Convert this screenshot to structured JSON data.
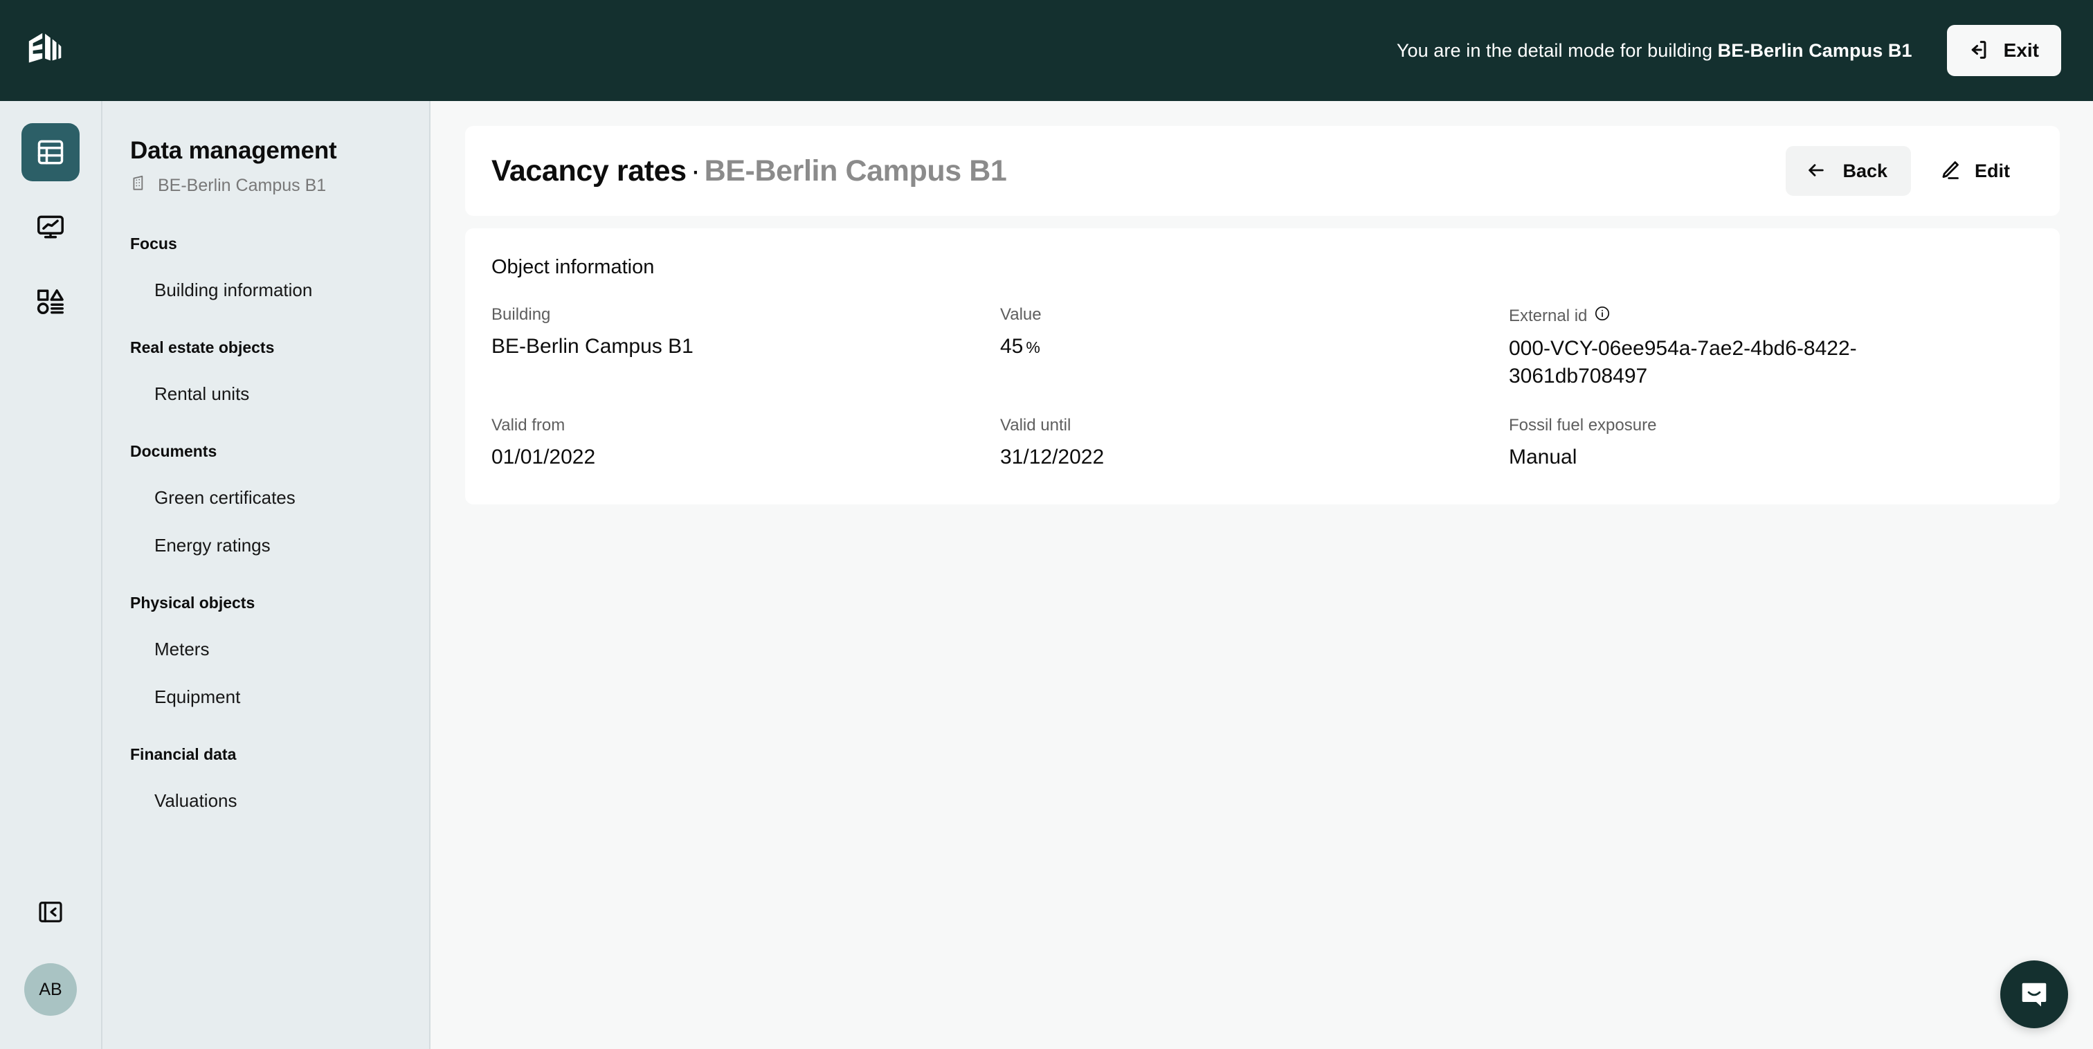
{
  "topbar": {
    "logo_icon": "building-logo-icon",
    "message_prefix": "You are in the detail mode for building ",
    "message_building": "BE-Berlin Campus B1",
    "exit_label": "Exit",
    "exit_icon": "exit-arrow-icon",
    "bg_color": "#14302F"
  },
  "rail": {
    "items": [
      {
        "name": "data-management",
        "icon": "table-grid-icon",
        "active": true
      },
      {
        "name": "monitoring",
        "icon": "monitor-chart-icon",
        "active": false
      },
      {
        "name": "categories",
        "icon": "shapes-list-icon",
        "active": false
      }
    ],
    "collapse_icon": "collapse-panel-icon",
    "avatar_initials": "AB",
    "avatar_color": "#A9C3C3",
    "active_color": "#2C5F67"
  },
  "sidebar": {
    "title": "Data management",
    "subtitle": "BE-Berlin Campus B1",
    "subtitle_icon": "building-icon",
    "groups": [
      {
        "label": "Focus",
        "items": [
          "Building information"
        ]
      },
      {
        "label": "Real estate objects",
        "items": [
          "Rental units"
        ]
      },
      {
        "label": "Documents",
        "items": [
          "Green certificates",
          "Energy ratings"
        ]
      },
      {
        "label": "Physical objects",
        "items": [
          "Meters",
          "Equipment"
        ]
      },
      {
        "label": "Financial data",
        "items": [
          "Valuations"
        ]
      }
    ]
  },
  "main": {
    "title": "Vacancy rates",
    "title_separator": "·",
    "title_context": "BE-Berlin Campus B1",
    "back_label": "Back",
    "back_icon": "arrow-left-icon",
    "edit_label": "Edit",
    "edit_icon": "pencil-icon",
    "info_card": {
      "heading": "Object information",
      "fields": [
        {
          "label": "Building",
          "value": "BE-Berlin Campus B1",
          "unit": "",
          "info_icon": false
        },
        {
          "label": "Value",
          "value": "45",
          "unit": "%",
          "info_icon": false
        },
        {
          "label": "External id",
          "value": "000-VCY-06ee954a-7ae2-4bd6-8422-3061db708497",
          "unit": "",
          "info_icon": true
        },
        {
          "label": "Valid from",
          "value": "01/01/2022",
          "unit": "",
          "info_icon": false
        },
        {
          "label": "Valid until",
          "value": "31/12/2022",
          "unit": "",
          "info_icon": false
        },
        {
          "label": "Fossil fuel exposure",
          "value": "Manual",
          "unit": "",
          "info_icon": false
        }
      ]
    }
  },
  "chat": {
    "icon": "chat-bubble-icon",
    "color": "#14302F"
  }
}
